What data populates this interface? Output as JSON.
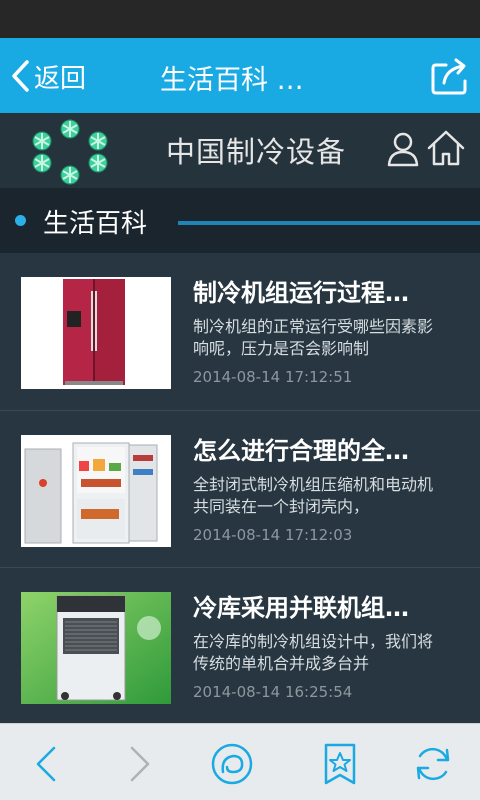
{
  "nav": {
    "back_label": "返回",
    "title": "生活百科 …"
  },
  "brand": {
    "name": "中国制冷设备"
  },
  "section": {
    "title": "生活百科"
  },
  "articles": [
    {
      "title": "制冷机组运行过程…",
      "summary": "制冷机组的正常运行受哪些因素影响呢，压力是否会影响制",
      "time": "2014-08-14 17:12:51",
      "image": "refrigerator-red-double-door"
    },
    {
      "title": "怎么进行合理的全…",
      "summary": "全封闭式制冷机组压缩机和电动机共同装在一个封闭壳内，",
      "time": "2014-08-14 17:12:03",
      "image": "refrigerator-open-white"
    },
    {
      "title": "冷库采用并联机组…",
      "summary": "在冷库的制冷机组设计中，我们将传统的单机合并成多台并",
      "time": "2014-08-14 16:25:54",
      "image": "dehumidifier-green-background"
    }
  ],
  "toolbar": {
    "icons": [
      "back-arrow-icon",
      "forward-arrow-icon",
      "browser-home-icon",
      "bookmark-star-icon",
      "refresh-icon"
    ]
  },
  "colors": {
    "accent": "#1aaae3",
    "nav_bg": "#1aaae3",
    "brand_bg": "#25333c",
    "list_bg": "#273640",
    "toolbar_bg": "#e8ebed",
    "toolbar_icon": "#1aaae3"
  }
}
